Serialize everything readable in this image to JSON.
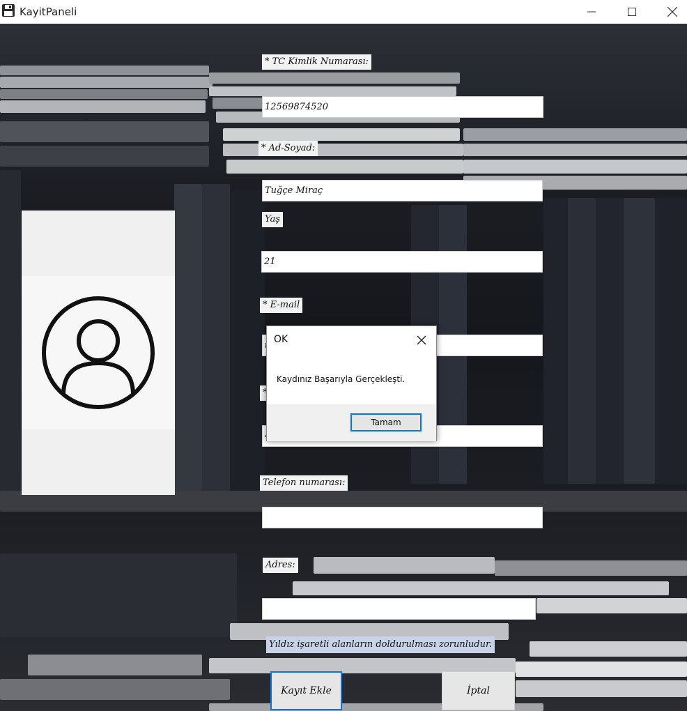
{
  "window": {
    "title": "KayitPaneli",
    "icons": {
      "app": "floppy-disk-icon",
      "minimize": "minimize-icon",
      "maximize": "maximize-icon",
      "close": "close-icon"
    }
  },
  "form": {
    "tc_label": "* TC Kimlik Numarası:",
    "tc_value": "12569874520",
    "name_label": "* Ad-Soyad:",
    "name_value": "Tuğçe Miraç",
    "age_label": "Yaş",
    "age_value": "21",
    "email_label": "* E-mail",
    "email_value_partial": "t",
    "hidden_label_partial": "*",
    "hidden_value_partial": "4",
    "phone_label": "Telefon numarası:",
    "phone_value": "",
    "address_label": "Adres:",
    "address_value": "",
    "required_note": "Yıldız işaretli alanların doldurulması zorunludur."
  },
  "buttons": {
    "save": "Kayıt Ekle",
    "cancel": "İptal"
  },
  "avatar": {
    "icon": "user-profile-icon"
  },
  "dialog": {
    "title": "OK",
    "message": "Kaydınız Başarıyla Gerçekleşti.",
    "ok_label": "Tamam",
    "close_icon": "close-icon"
  },
  "colors": {
    "accent": "#0b74d8",
    "note_bg": "#c9d3e8"
  }
}
